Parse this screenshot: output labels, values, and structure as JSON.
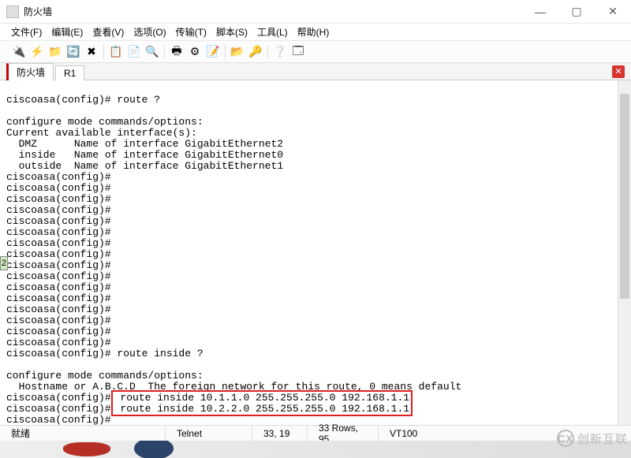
{
  "window": {
    "title": "防火墙",
    "minimize": "—",
    "maximize": "▢",
    "close": "✕"
  },
  "menu": {
    "file": "文件(F)",
    "edit": "编辑(E)",
    "view": "查看(V)",
    "options": "选项(O)",
    "transfer": "传输(T)",
    "script": "脚本(S)",
    "tools": "工具(L)",
    "help": "帮助(H)"
  },
  "tabs": {
    "t1": "防火墙",
    "t2": "R1"
  },
  "terminal_lines": [
    "ciscoasa(config)# route ?",
    "",
    "configure mode commands/options:",
    "Current available interface(s):",
    "  DMZ      Name of interface GigabitEthernet2",
    "  inside   Name of interface GigabitEthernet0",
    "  outside  Name of interface GigabitEthernet1",
    "ciscoasa(config)#",
    "ciscoasa(config)#",
    "ciscoasa(config)#",
    "ciscoasa(config)#",
    "ciscoasa(config)#",
    "ciscoasa(config)#",
    "ciscoasa(config)#",
    "ciscoasa(config)#",
    "ciscoasa(config)#",
    "ciscoasa(config)#",
    "ciscoasa(config)#",
    "ciscoasa(config)#",
    "ciscoasa(config)#",
    "ciscoasa(config)#",
    "ciscoasa(config)#",
    "ciscoasa(config)#",
    "ciscoasa(config)# route inside ?",
    "",
    "configure mode commands/options:",
    "  Hostname or A.B.C.D  The foreign network for this route, 0 means default"
  ],
  "highlight_lines": [
    "ciscoasa(config)# route inside 10.1.1.0 255.255.255.0 192.168.1.1",
    "ciscoasa(config)# route inside 10.2.2.0 255.255.255.0 192.168.1.1"
  ],
  "terminal_tail": [
    "ciscoasa(config)#"
  ],
  "status": {
    "ready": "就绪",
    "conn": "Telnet",
    "pos": "33, 19",
    "size": "33 Rows, 95",
    "term": "VT100"
  },
  "sidetab": "2",
  "watermark": "创新互联"
}
